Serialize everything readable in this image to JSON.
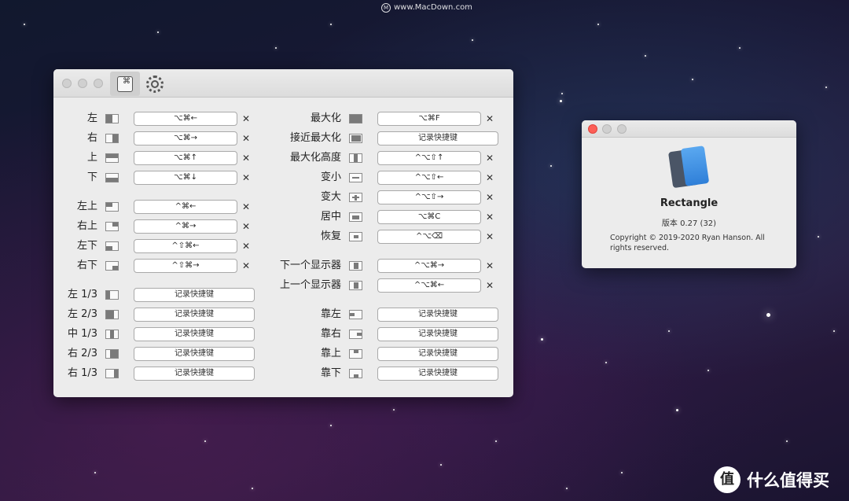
{
  "watermarks": {
    "top": "www.MacDown.com",
    "top_logo": "M",
    "bottom_right": "什么值得买",
    "bottom_right_logo": "值"
  },
  "main_window": {
    "toolbar": {
      "shortcuts_tab_icon": "keyboard-shortcuts-icon",
      "settings_tab_icon": "gear-icon"
    },
    "left_column": [
      {
        "label": "左",
        "icon": "left-half",
        "shortcut": "⌥⌘←",
        "clearable": true
      },
      {
        "label": "右",
        "icon": "right-half",
        "shortcut": "⌥⌘→",
        "clearable": true
      },
      {
        "label": "上",
        "icon": "top-half",
        "shortcut": "⌥⌘↑",
        "clearable": true
      },
      {
        "label": "下",
        "icon": "bottom-half",
        "shortcut": "⌥⌘↓",
        "clearable": true
      },
      {
        "label": "左上",
        "icon": "top-left",
        "shortcut": "^⌘←",
        "clearable": true
      },
      {
        "label": "右上",
        "icon": "top-right",
        "shortcut": "^⌘→",
        "clearable": true
      },
      {
        "label": "左下",
        "icon": "bottom-left",
        "shortcut": "^⇧⌘←",
        "clearable": true
      },
      {
        "label": "右下",
        "icon": "bottom-right",
        "shortcut": "^⇧⌘→",
        "clearable": true
      },
      {
        "label": "左 1/3",
        "icon": "first-third",
        "shortcut": "记录快捷键",
        "clearable": false
      },
      {
        "label": "左 2/3",
        "icon": "first-two-thirds",
        "shortcut": "记录快捷键",
        "clearable": false
      },
      {
        "label": "中 1/3",
        "icon": "center-third",
        "shortcut": "记录快捷键",
        "clearable": false
      },
      {
        "label": "右 2/3",
        "icon": "last-two-thirds",
        "shortcut": "记录快捷键",
        "clearable": false
      },
      {
        "label": "右 1/3",
        "icon": "last-third",
        "shortcut": "记录快捷键",
        "clearable": false
      }
    ],
    "right_column": [
      {
        "label": "最大化",
        "icon": "maximize",
        "shortcut": "⌥⌘F",
        "clearable": true
      },
      {
        "label": "接近最大化",
        "icon": "almost-maximize",
        "shortcut": "记录快捷键",
        "clearable": false
      },
      {
        "label": "最大化高度",
        "icon": "maximize-height",
        "shortcut": "^⌥⇧↑",
        "clearable": true
      },
      {
        "label": "变小",
        "icon": "smaller",
        "shortcut": "^⌥⇧←",
        "clearable": true
      },
      {
        "label": "变大",
        "icon": "larger",
        "shortcut": "^⌥⇧→",
        "clearable": true
      },
      {
        "label": "居中",
        "icon": "center",
        "shortcut": "⌥⌘C",
        "clearable": true
      },
      {
        "label": "恢复",
        "icon": "restore",
        "shortcut": "^⌥⌫",
        "clearable": true
      },
      {
        "label": "下一个显示器",
        "icon": "next-display",
        "shortcut": "^⌥⌘→",
        "clearable": true
      },
      {
        "label": "上一个显示器",
        "icon": "previous-display",
        "shortcut": "^⌥⌘←",
        "clearable": true
      },
      {
        "label": "靠左",
        "icon": "move-left",
        "shortcut": "记录快捷键",
        "clearable": false
      },
      {
        "label": "靠右",
        "icon": "move-right",
        "shortcut": "记录快捷键",
        "clearable": false
      },
      {
        "label": "靠上",
        "icon": "move-up",
        "shortcut": "记录快捷键",
        "clearable": false
      },
      {
        "label": "靠下",
        "icon": "move-down",
        "shortcut": "记录快捷键",
        "clearable": false
      }
    ],
    "clear_glyph": "✕"
  },
  "about_window": {
    "app_name": "Rectangle",
    "version": "版本 0.27 (32)",
    "copyright": "Copyright © 2019-2020 Ryan Hanson. All rights reserved.",
    "app_icon": "rectangle-app-icon"
  },
  "colors": {
    "accent_close": "#fd5f57",
    "window_bg": "#ececec",
    "icon_fill": "#7a7a7a"
  }
}
